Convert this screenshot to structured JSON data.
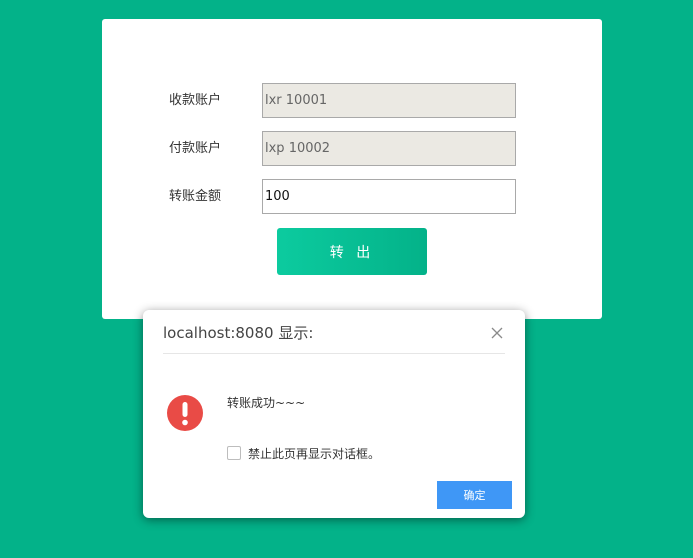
{
  "form": {
    "payee": {
      "label": "收款账户",
      "value": "lxr 10001"
    },
    "payer": {
      "label": "付款账户",
      "value": "lxp 10002"
    },
    "amount": {
      "label": "转账金额",
      "value": "100"
    },
    "submit_label": "转 出"
  },
  "dialog": {
    "title": "localhost:8080 显示:",
    "message": "转账成功~~~",
    "suppress_label": "禁止此页再显示对话框。",
    "ok_label": "确定",
    "icons": {
      "alert": "exclamation-circle-icon",
      "close": "close-icon"
    }
  },
  "colors": {
    "background": "#03b289",
    "button_start": "#0ccb9f",
    "button_end": "#03b289",
    "alert_icon": "#e94b46",
    "ok_button": "#3f97f6",
    "readonly_input": "#ebe9e3"
  }
}
